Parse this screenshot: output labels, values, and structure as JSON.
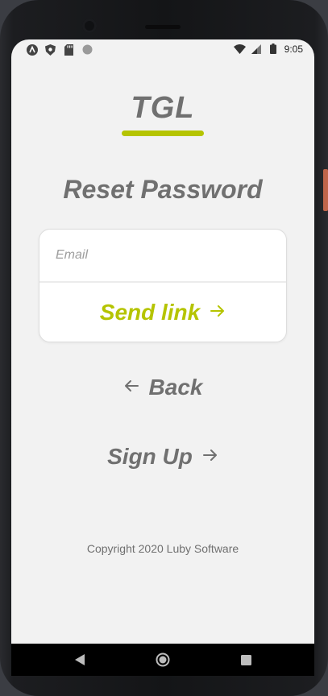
{
  "status_bar": {
    "time": "9:05",
    "left_icons": [
      "android-icon",
      "shield-icon",
      "sd-card-icon",
      "dot-icon"
    ],
    "right_icons": [
      "wifi-icon",
      "signal-icon",
      "battery-icon"
    ]
  },
  "logo": {
    "text": "TGL"
  },
  "page": {
    "title": "Reset Password"
  },
  "form": {
    "email_placeholder": "Email",
    "email_value": "",
    "send_label": "Send link"
  },
  "links": {
    "back_label": "Back",
    "signup_label": "Sign Up"
  },
  "footer": {
    "copyright": "Copyright 2020 Luby Software"
  },
  "colors": {
    "accent": "#b5c401",
    "text_gray": "#707070",
    "background": "#f2f2f2"
  },
  "nav_bar": {
    "buttons": [
      "back-triangle-icon",
      "home-circle-icon",
      "recents-square-icon"
    ]
  }
}
